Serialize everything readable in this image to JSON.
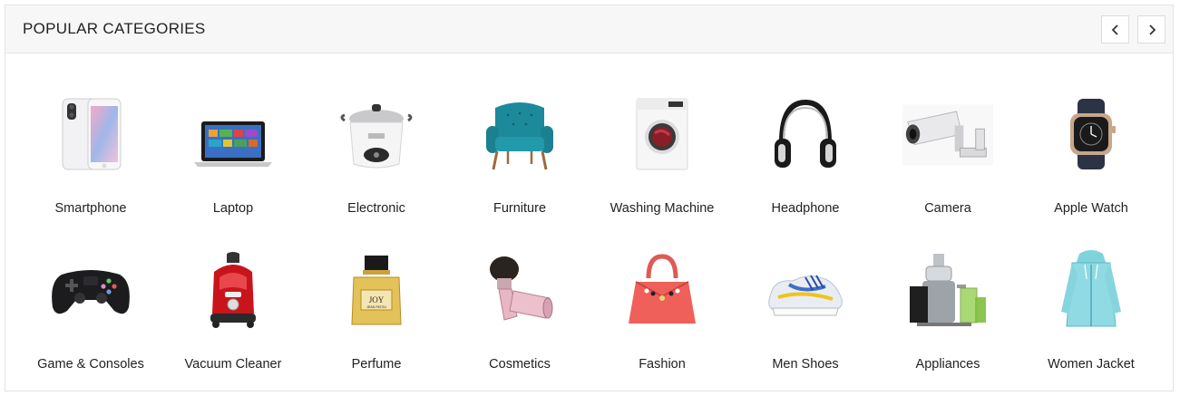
{
  "section": {
    "title": "POPULAR CATEGORIES",
    "prev_icon": "chevron-left-icon",
    "next_icon": "chevron-right-icon"
  },
  "categories": [
    {
      "label": "Smartphone",
      "icon": "smartphone-icon"
    },
    {
      "label": "Laptop",
      "icon": "laptop-icon"
    },
    {
      "label": "Electronic",
      "icon": "rice-cooker-icon"
    },
    {
      "label": "Furniture",
      "icon": "armchair-icon"
    },
    {
      "label": "Washing Machine",
      "icon": "washing-machine-icon"
    },
    {
      "label": "Headphone",
      "icon": "headphone-icon"
    },
    {
      "label": "Camera",
      "icon": "cctv-camera-icon"
    },
    {
      "label": "Apple Watch",
      "icon": "smartwatch-icon"
    },
    {
      "label": "Game & Consoles",
      "icon": "gamepad-icon"
    },
    {
      "label": "Vacuum Cleaner",
      "icon": "vacuum-cleaner-icon"
    },
    {
      "label": "Perfume",
      "icon": "perfume-bottle-icon"
    },
    {
      "label": "Cosmetics",
      "icon": "makeup-brush-icon"
    },
    {
      "label": "Fashion",
      "icon": "handbag-icon"
    },
    {
      "label": "Men Shoes",
      "icon": "sneaker-icon"
    },
    {
      "label": "Appliances",
      "icon": "juicer-icon"
    },
    {
      "label": "Women Jacket",
      "icon": "hoodie-icon"
    }
  ]
}
